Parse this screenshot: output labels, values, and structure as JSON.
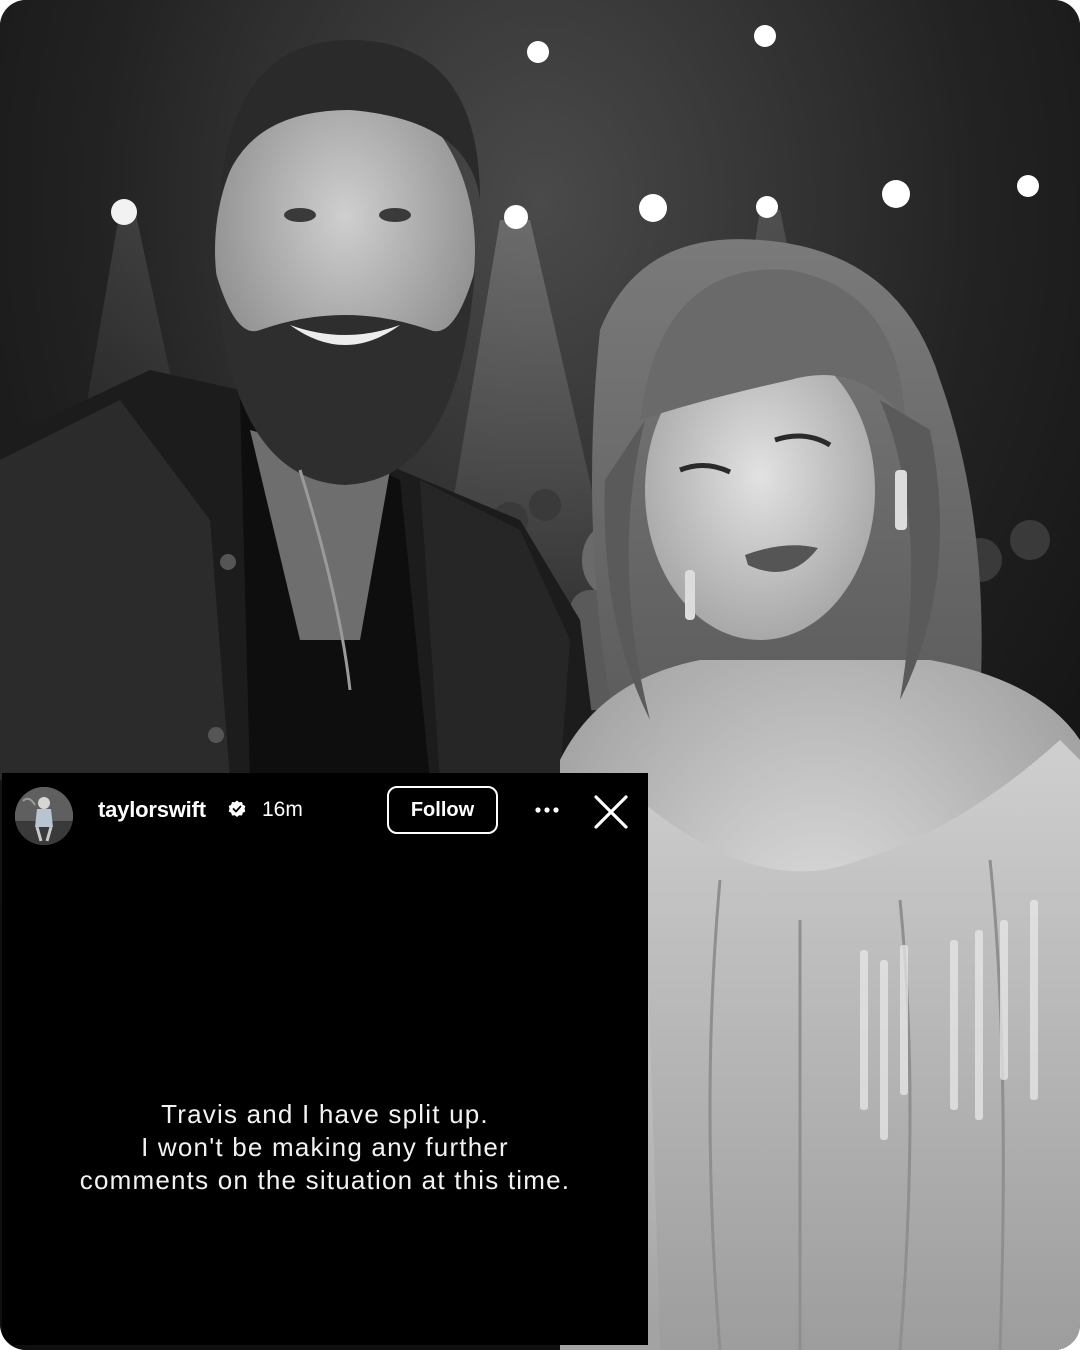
{
  "story": {
    "username": "taylorswift",
    "time": "16m",
    "follow_label": "Follow",
    "text_lines": [
      "Travis and I have split up.",
      "I won't be making any further",
      "comments on the situation at this time."
    ]
  },
  "icons": {
    "verified": "verified-badge-icon",
    "more": "more-options-icon",
    "close": "close-icon"
  },
  "colors": {
    "story_background": "#000000",
    "text": "#ffffff"
  }
}
